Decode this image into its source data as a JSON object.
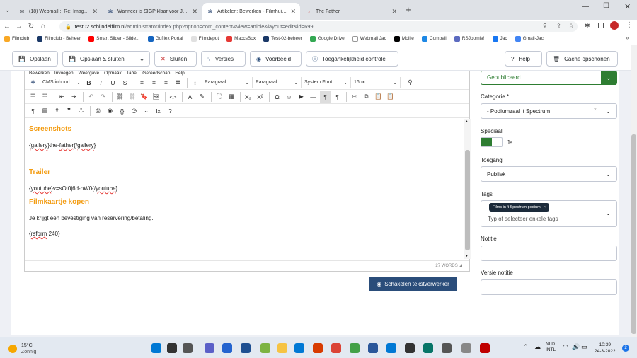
{
  "browser": {
    "tabs": [
      {
        "label": "(18) Webmail :: Re: Image gallery",
        "icon": "mail-icon",
        "color": "#5f6368"
      },
      {
        "label": "Wanneer is SIGP klaar voor Joomla",
        "icon": "joomla-icon",
        "color": "#1a3867"
      },
      {
        "label": "Artikelen: Bewerken - Filmhuis Sp",
        "icon": "joomla-icon",
        "color": "#1a3867",
        "active": true
      },
      {
        "label": "The Father",
        "icon": "fm-icon",
        "color": "#d32f2f"
      }
    ],
    "new_tab": "+",
    "url_host": "test02.schijndelfilm.nl",
    "url_path": "/administrator/index.php?option=com_content&view=article&layout=edit&id=699",
    "bookmarks": [
      {
        "label": "Filmclub",
        "color": "#f9a825"
      },
      {
        "label": "Filmclub - Beheer",
        "color": "#1a3867"
      },
      {
        "label": "Smart Slider - Slide...",
        "color": "#ff0000"
      },
      {
        "label": "Gofilex Portal",
        "color": "#1565c0"
      },
      {
        "label": "Filmdepot",
        "color": "#e0e0e0"
      },
      {
        "label": "MaccsBox",
        "color": "#e53935"
      },
      {
        "label": "Test-02-beheer",
        "color": "#1a3867"
      },
      {
        "label": "Google Drive",
        "color": "#34a853"
      },
      {
        "label": "Webmail Jac",
        "color": "#ffffff"
      },
      {
        "label": "Mollie",
        "color": "#000000"
      },
      {
        "label": "Combell",
        "color": "#1e88e5"
      },
      {
        "label": "RSJoomla!",
        "color": "#5c6bc0"
      },
      {
        "label": "Jac",
        "color": "#1877f2"
      },
      {
        "label": "Gmail-Jac",
        "color": "#4285f4"
      }
    ],
    "more": "»"
  },
  "toolbar": {
    "save": "Opslaan",
    "save_close": "Opslaan & sluiten",
    "close": "Sluiten",
    "versions": "Versies",
    "preview": "Voorbeeld",
    "accessibility": "Toegankelijkheid controle",
    "help": "Help",
    "cache": "Cache opschonen"
  },
  "editor": {
    "menubar": [
      "Bewerken",
      "Invoegen",
      "Weergave",
      "Opmaak",
      "Tabel",
      "Gereedschap",
      "Help"
    ],
    "cms_content": "CMS inhoud",
    "paragraph1": "Paragraaf",
    "paragraph2": "Paragraaf",
    "font": "System Font",
    "size": "16px",
    "blocks": [
      {
        "type": "h",
        "text": "Screenshots"
      },
      {
        "type": "p",
        "parts": [
          "{",
          "gallery",
          "}the-",
          "father",
          "{/",
          "gallery",
          "}"
        ]
      },
      {
        "type": "h",
        "text": "Trailer",
        "gap": true
      },
      {
        "type": "p",
        "parts": [
          "{",
          "youtube",
          "}v=sOt0j6d-nW0{/",
          "youtube",
          "}"
        ]
      },
      {
        "type": "h",
        "text": "Filmkaartje kopen"
      },
      {
        "type": "p",
        "parts": [
          "Je krijgt een bevestiging van reservering/betaling."
        ]
      },
      {
        "type": "p",
        "parts": [
          "{",
          "rsform",
          " 240}"
        ]
      }
    ],
    "word_count": "27 WORDS",
    "toggle_button": "Schakelen tekstverwerker"
  },
  "sidebar": {
    "status_value": "Gepubliceerd",
    "category_label": "Categorie *",
    "category_value": "- Podiumzaal 't Spectrum",
    "featured_label": "Speciaal",
    "featured_value": "Ja",
    "access_label": "Toegang",
    "access_value": "Publiek",
    "tags_label": "Tags",
    "tag_chip": "Films in 't Spectrum podium",
    "tags_placeholder": "Typ of selecteer enkele tags",
    "note_label": "Notitie",
    "version_note_label": "Versie notitie"
  },
  "taskbar": {
    "weather_temp": "15°C",
    "weather_text": "Zonnig",
    "lang1": "NLD",
    "lang2": "INTL",
    "time": "10:39",
    "date": "24-3-2022",
    "notif_count": "2"
  },
  "colors": {
    "accent": "#f39c12",
    "green": "#2e7d32",
    "navy": "#2a4d7a"
  }
}
